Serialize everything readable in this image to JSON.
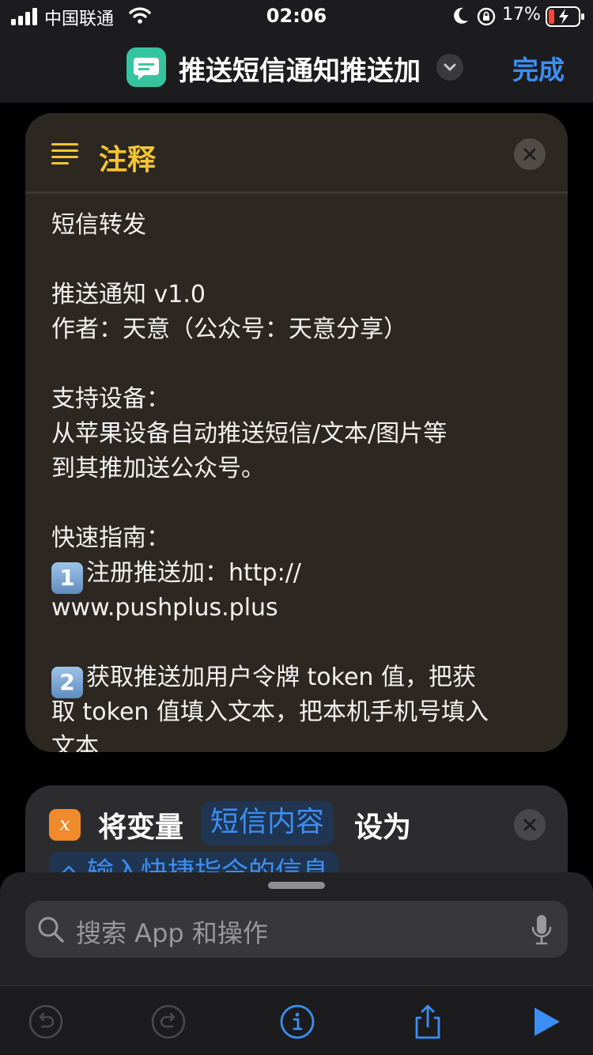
{
  "status_bar": {
    "carrier": "中国联通",
    "time": "02:06",
    "battery_percent": "17%"
  },
  "nav": {
    "title": "推送短信通知推送加",
    "done": "完成"
  },
  "comment_card": {
    "title": "注释",
    "lines": [
      "短信转发",
      "",
      "推送通知  v1.0",
      "作者：天意（公众号：天意分享）",
      "",
      "支持设备：",
      "从苹果设备自动推送短信/文本/图片等",
      "到其推加送公众号。",
      "",
      "快速指南：",
      "注册推送加：http://",
      "www.pushplus.plus",
      "",
      "获取推送加用户令牌 token 值，把获",
      "取 token 值填入文本，把本机手机号填入",
      "文本"
    ],
    "badge_1": "1",
    "badge_2": "2",
    "guide_step1": "注册推送加：http://",
    "guide_step1_cont": "www.pushplus.plus",
    "guide_step2": "获取推送加用户令牌 token 值，把获",
    "guide_step2_cont": "取 token 值填入文本，把本机手机号填入",
    "guide_step2_end": "文本"
  },
  "variable_card": {
    "icon_letter": "x",
    "set_label": "将变量",
    "variable_name": "短信内容",
    "to_label": "设为",
    "input_value": "输入快捷指令的信息"
  },
  "search": {
    "placeholder": "搜索 App 和操作"
  },
  "toolbar": {
    "icons": [
      "undo-icon",
      "redo-icon",
      "info-icon",
      "share-icon",
      "play-icon"
    ]
  },
  "colors": {
    "accent_blue": "#3b8ef3",
    "comment_yellow": "#f5c432",
    "variable_orange": "#f08a2a",
    "app_icon_green": "#34c5a0"
  }
}
